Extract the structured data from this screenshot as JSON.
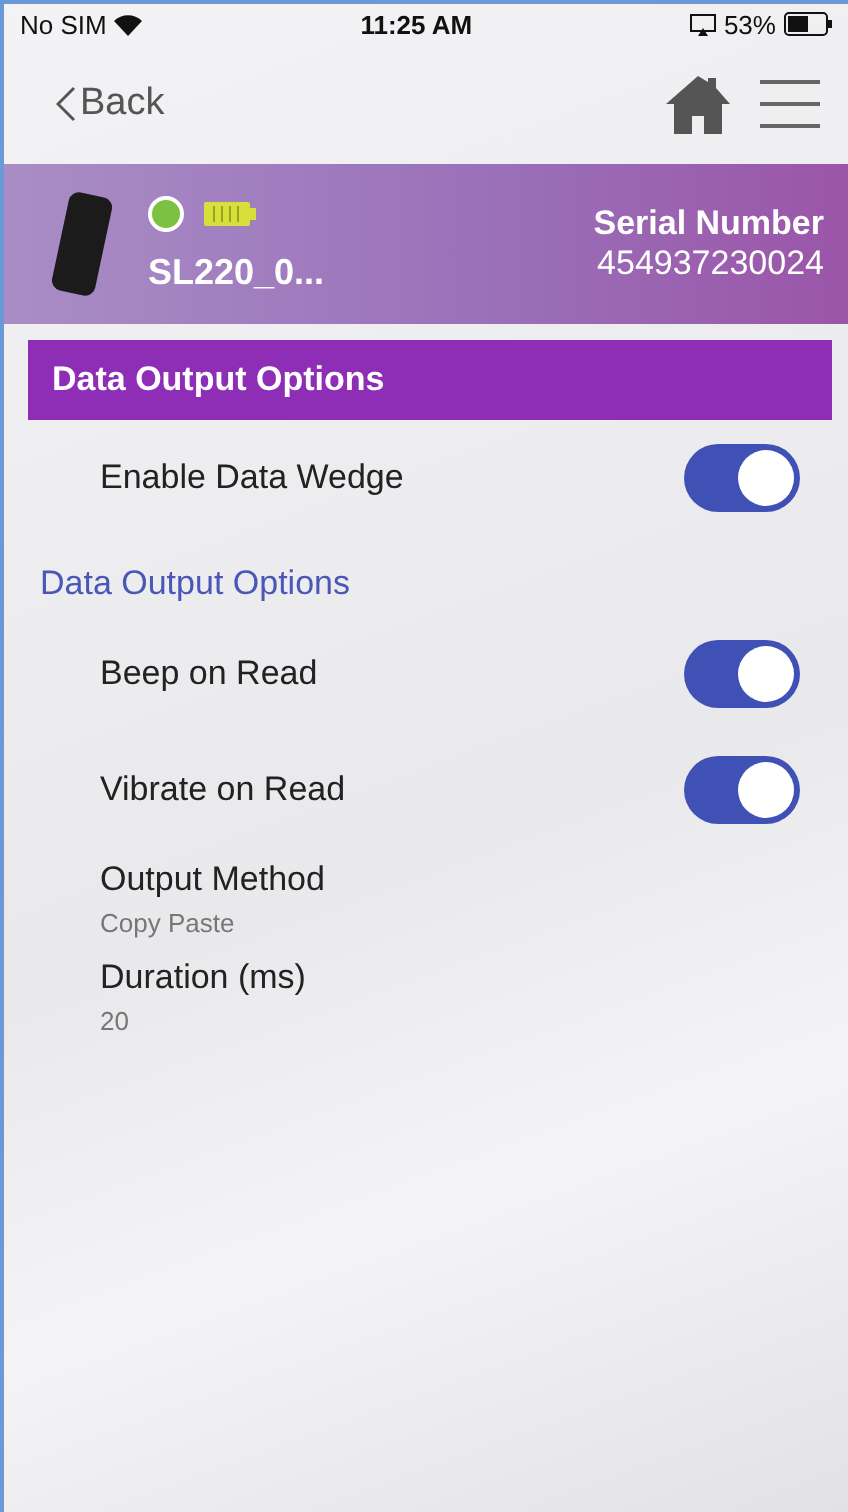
{
  "status_bar": {
    "carrier": "No SIM",
    "time": "11:25 AM",
    "battery": "53%"
  },
  "nav": {
    "back": "Back"
  },
  "device": {
    "name": "SL220_0...",
    "connected": true,
    "serial_label": "Serial Number",
    "serial": "454937230024"
  },
  "header": {
    "title": "Data Output Options"
  },
  "items": [
    {
      "kind": "toggle",
      "label": "Enable Data Wedge",
      "on": true
    },
    {
      "kind": "section",
      "label": "Data Output Options"
    },
    {
      "kind": "toggle",
      "label": "Beep on Read",
      "on": true
    },
    {
      "kind": "toggle",
      "label": "Vibrate on Read",
      "on": true
    },
    {
      "kind": "value",
      "label": "Output Method",
      "value": "Copy Paste"
    },
    {
      "kind": "value",
      "label": "Duration (ms)",
      "value": "20"
    }
  ]
}
